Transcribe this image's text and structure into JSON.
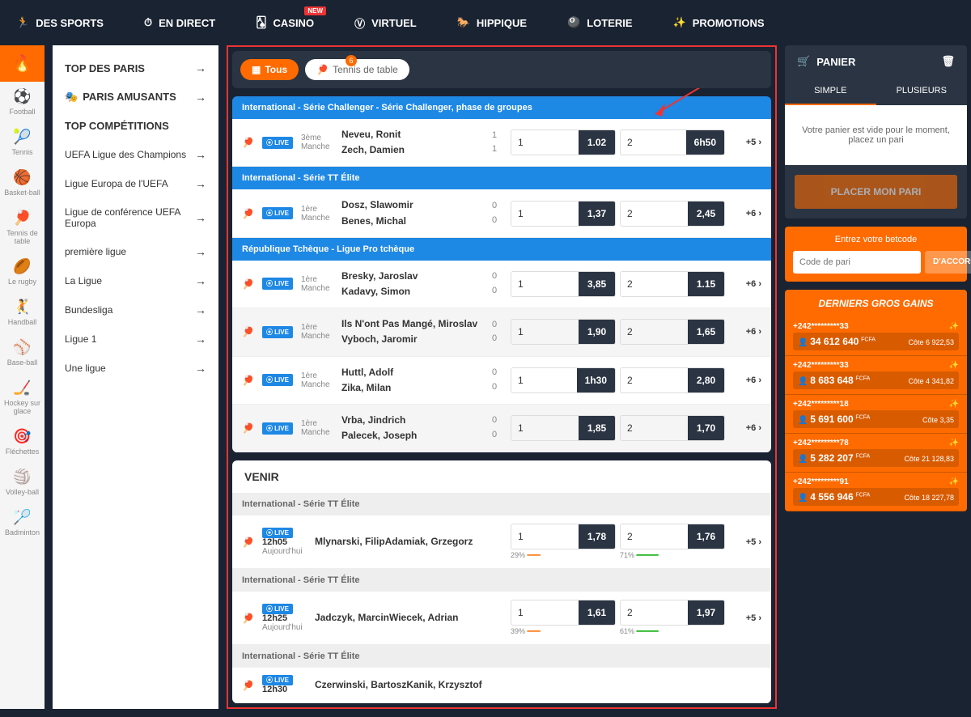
{
  "topnav": {
    "sports": "DES SPORTS",
    "live": "EN DIRECT",
    "casino": "CASINO",
    "casino_badge": "NEW",
    "virtual": "VIRTUEL",
    "horse": "HIPPIQUE",
    "lottery": "LOTERIE",
    "promo": "PROMOTIONS"
  },
  "sports_sidebar": [
    "Football",
    "Tennis",
    "Basket-ball",
    "Tennis de table",
    "Le rugby",
    "Handball",
    "Base-ball",
    "Hockey sur glace",
    "Fléchettes",
    "Volley-ball",
    "Badminton"
  ],
  "left_panel": {
    "top_paris": "TOP DES PARIS",
    "paris_amusants": "PARIS AMUSANTS",
    "top_comp": "TOP COMPÉTITIONS",
    "items": [
      "UEFA Ligue des Champions",
      "Ligue Europa de l'UEFA",
      "Ligue de conférence UEFA Europa",
      "première ligue",
      "La Ligue",
      "Bundesliga",
      "Ligue 1",
      "Une ligue"
    ]
  },
  "filters": {
    "all": "Tous",
    "tt": "Tennis de table",
    "count": "6"
  },
  "leagues": [
    {
      "title": "International  - Série Challenger  - Série Challenger, phase de groupes",
      "events": [
        {
          "manche_num": "3ème",
          "manche_lbl": "Manche",
          "p1": "Neveu, Ronit",
          "p2": "Zech, Damien",
          "s1": "1",
          "s2": "1",
          "o1": "1.02",
          "o2": "6h50",
          "more": "+5",
          "alt": false
        }
      ]
    },
    {
      "title": "International  - Série TT Élite",
      "events": [
        {
          "manche_num": "1ère",
          "manche_lbl": "Manche",
          "p1": "Dosz, Slawomir",
          "p2": "Benes, Michal",
          "s1": "0",
          "s2": "0",
          "o1": "1,37",
          "o2": "2,45",
          "more": "+6",
          "alt": false
        }
      ]
    },
    {
      "title": "République Tchèque  - Ligue Pro tchèque",
      "events": [
        {
          "manche_num": "1ère",
          "manche_lbl": "Manche",
          "p1": "Bresky, Jaroslav",
          "p2": "Kadavy, Simon",
          "s1": "0",
          "s2": "0",
          "o1": "3,85",
          "o2": "1.15",
          "more": "+6",
          "alt": false
        },
        {
          "manche_num": "1ère",
          "manche_lbl": "Manche",
          "p1": "Ils N'ont Pas Mangé, Miroslav",
          "p2": "Vyboch, Jaromir",
          "s1": "0",
          "s2": "0",
          "o1": "1,90",
          "o2": "1,65",
          "more": "+6",
          "alt": true
        },
        {
          "manche_num": "1ère",
          "manche_lbl": "Manche",
          "p1": "Huttl, Adolf",
          "p2": "Zika, Milan",
          "s1": "0",
          "s2": "0",
          "o1": "1h30",
          "o2": "2,80",
          "more": "+6",
          "alt": false
        },
        {
          "manche_num": "1ère",
          "manche_lbl": "Manche",
          "p1": "Vrba, Jindrich",
          "p2": "Palecek, Joseph",
          "s1": "0",
          "s2": "0",
          "o1": "1,85",
          "o2": "1,70",
          "more": "+6",
          "alt": true
        }
      ]
    }
  ],
  "venir": {
    "title": "VENIR",
    "leagues": [
      {
        "title": "International  - Série TT Élite",
        "events": [
          {
            "time": "12h05",
            "day": "Aujourd'hui",
            "players": "Mlynarski, FilipAdamiak, Grzegorz",
            "o1": "1,78",
            "o2": "1,76",
            "more": "+5",
            "pct1": "29%",
            "pct2": "71%"
          }
        ]
      },
      {
        "title": "International  - Série TT Élite",
        "events": [
          {
            "time": "12h25",
            "day": "Aujourd'hui",
            "players": "Jadczyk, MarcinWiecek, Adrian",
            "o1": "1,61",
            "o2": "1,97",
            "more": "+5",
            "pct1": "39%",
            "pct2": "61%"
          }
        ]
      },
      {
        "title": "International  - Série TT Élite",
        "events": [
          {
            "time": "12h30",
            "day": "",
            "players": "Czerwinski, BartoszKanik, Krzysztof",
            "o1": "",
            "o2": "",
            "more": "",
            "pct1": "",
            "pct2": ""
          }
        ]
      }
    ]
  },
  "basket": {
    "title": "PANIER",
    "tab1": "SIMPLE",
    "tab2": "PLUSIEURS",
    "empty": "Votre panier est vide pour le moment, placez un pari",
    "place": "PLACER MON PARI"
  },
  "betcode": {
    "title": "Entrez votre betcode",
    "placeholder": "Code de pari",
    "btn": "D'ACCORD"
  },
  "wins": {
    "title": "DERNIERS GROS GAINS",
    "items": [
      {
        "phone": "+242*********33",
        "amount": "34 612 640",
        "cur": "FCFA",
        "cote": "Côte  6 922,53"
      },
      {
        "phone": "+242*********33",
        "amount": "8 683 648",
        "cur": "FCFA",
        "cote": "Côte  4 341,82"
      },
      {
        "phone": "+242*********18",
        "amount": "5 691 600",
        "cur": "FCFA",
        "cote": "Côte  3,35"
      },
      {
        "phone": "+242*********78",
        "amount": "5 282 207",
        "cur": "FCFA",
        "cote": "Côte  21 128,83"
      },
      {
        "phone": "+242*********91",
        "amount": "4 556 946",
        "cur": "FCFA",
        "cote": "Côte  18 227,78"
      }
    ]
  },
  "labels": {
    "one": "1",
    "two": "2",
    "live": "⦿ LIVE"
  }
}
